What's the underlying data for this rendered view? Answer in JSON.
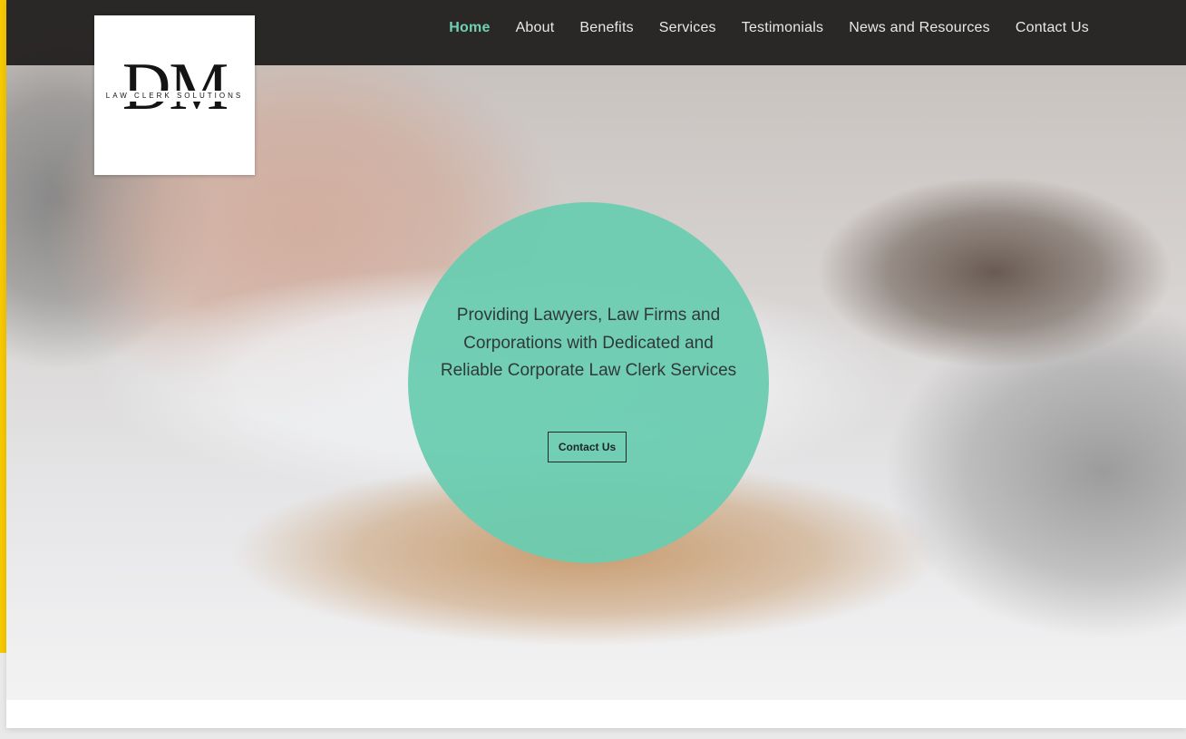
{
  "logo": {
    "letters": "DM",
    "subtitle": "LAW CLERK SOLUTIONS"
  },
  "nav": {
    "items": [
      {
        "label": "Home",
        "active": true
      },
      {
        "label": "About",
        "active": false
      },
      {
        "label": "Benefits",
        "active": false
      },
      {
        "label": "Services",
        "active": false
      },
      {
        "label": "Testimonials",
        "active": false
      },
      {
        "label": "News and Resources",
        "active": false
      },
      {
        "label": "Contact Us",
        "active": false
      }
    ]
  },
  "hero": {
    "tagline": "Providing Lawyers, Law Firms and Corporations with Dedicated and Reliable Corporate Law Clerk Services",
    "cta_label": "Contact Us"
  },
  "colors": {
    "accent": "#6fd0b4",
    "circle": "#6accb0",
    "header": "#1e1c1b",
    "edge": "#f5c800"
  }
}
